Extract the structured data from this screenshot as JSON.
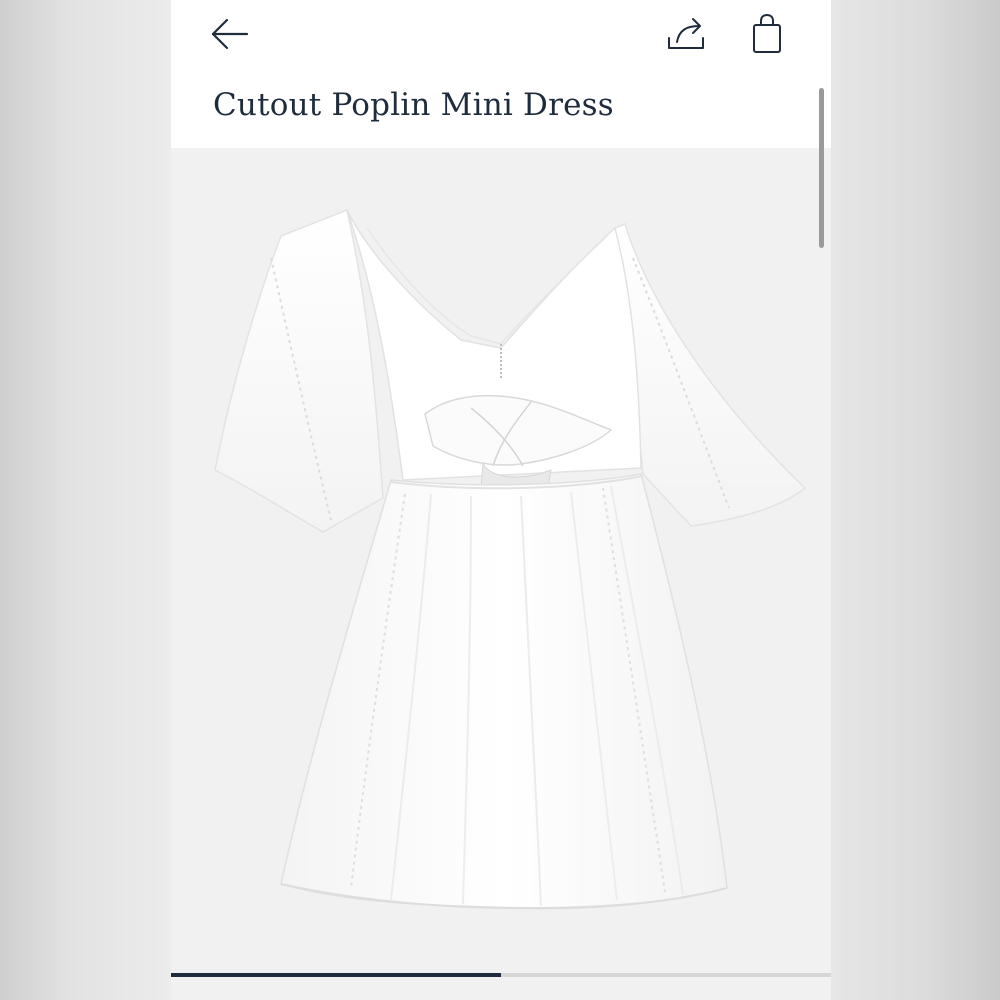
{
  "product": {
    "title": "Cutout Poplin Mini Dress",
    "image_alt": "white dress"
  },
  "header": {
    "back_icon": "arrow-left-icon",
    "share_icon": "share-icon",
    "bag_icon": "shopping-bag-icon"
  },
  "gallery": {
    "progress_fraction": 0.5
  },
  "colors": {
    "title": "#1f2c3d",
    "icon": "#1f2c3d",
    "image_background": "#f1f1f1",
    "progress_fill": "#1f2c3d"
  }
}
